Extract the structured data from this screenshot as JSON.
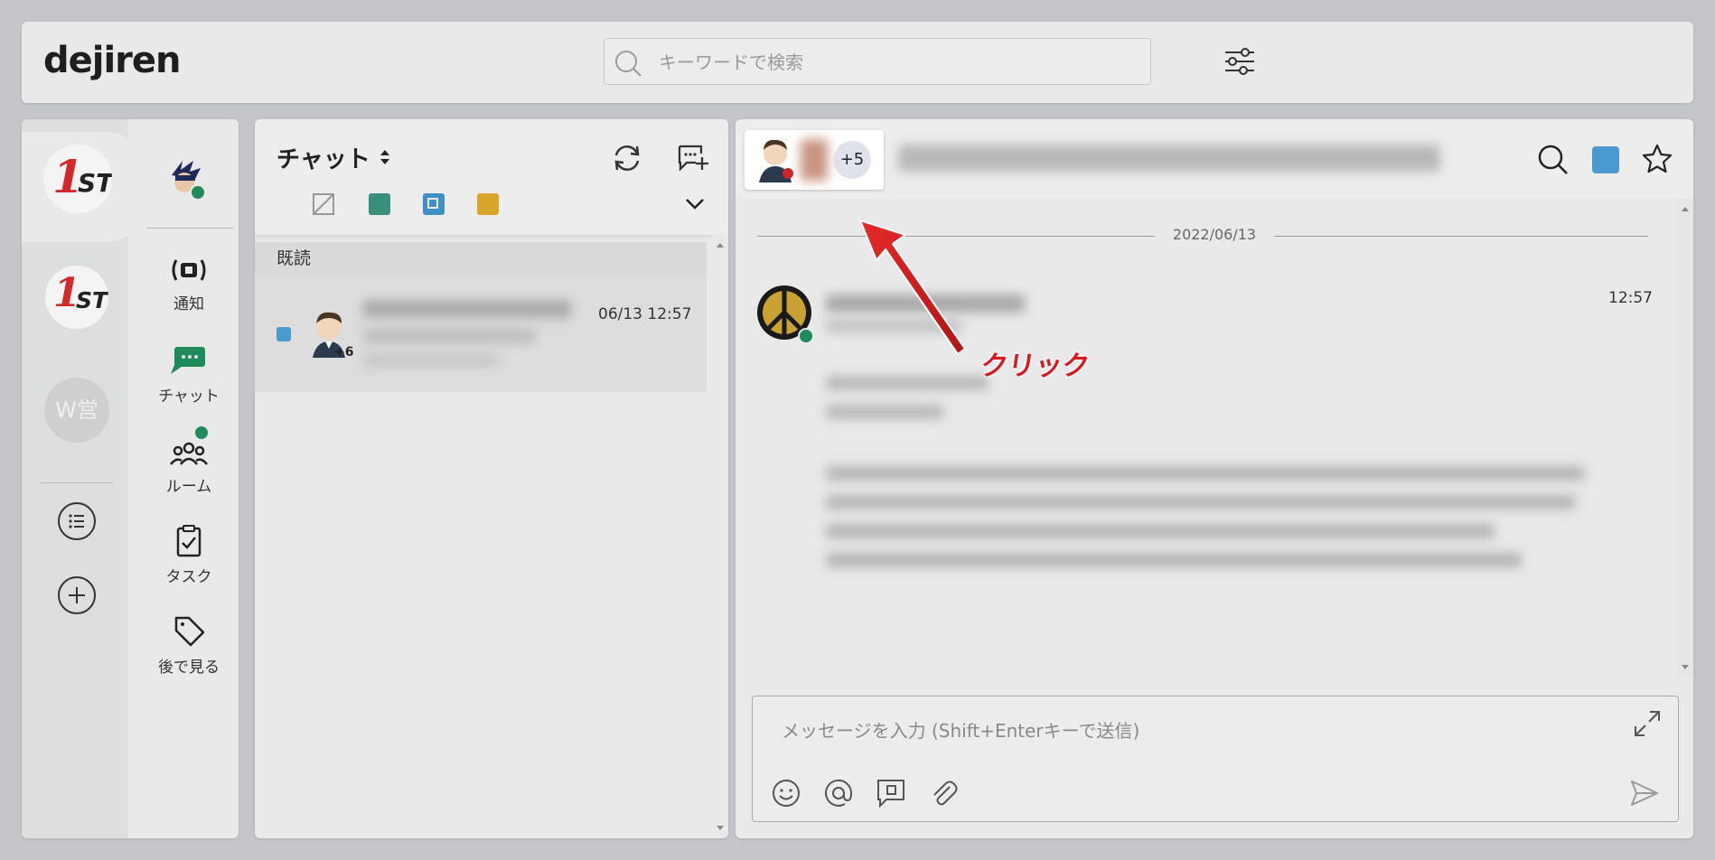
{
  "app": {
    "name": "dejiren"
  },
  "search": {
    "placeholder": "キーワードで検索"
  },
  "orgs": [
    {
      "label_one": "1",
      "label_st": "ST",
      "active": true
    },
    {
      "label_one": "1",
      "label_st": "ST",
      "active": false
    },
    {
      "label": "W営",
      "active": false
    }
  ],
  "nav": {
    "items": [
      {
        "label": "通知",
        "icon": "notification-icon"
      },
      {
        "label": "チャット",
        "icon": "chat-icon"
      },
      {
        "label": "ルーム",
        "icon": "room-icon"
      },
      {
        "label": "タスク",
        "icon": "task-icon"
      },
      {
        "label": "後で見る",
        "icon": "bookmark-tag-icon"
      }
    ]
  },
  "chat_list": {
    "title": "チャット",
    "section_label": "既読",
    "filter_colors": [
      "#3a8f7a",
      "#3f8fc4",
      "#d9a52b"
    ],
    "rows": [
      {
        "time": "06/13 12:57",
        "member_badge": "+6",
        "unread_color": "#4a9ad0"
      }
    ]
  },
  "chat_pane": {
    "member_more": "+5",
    "date_separator": "2022/06/13",
    "message_time": "12:57",
    "composer_placeholder": "メッセージを入力 (Shift+Enterキーで送信)",
    "accent_color": "#4a9ad0"
  },
  "annotation": {
    "text": "クリック",
    "color": "#d8181e"
  }
}
